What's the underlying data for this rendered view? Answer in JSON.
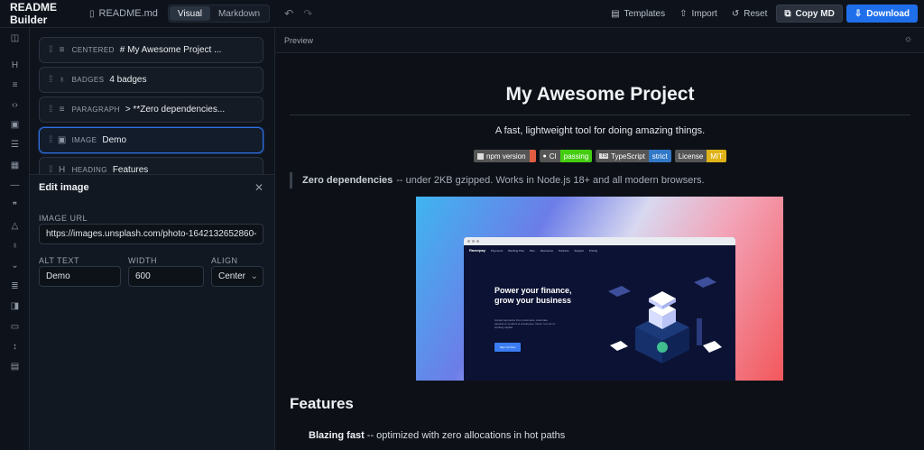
{
  "app": {
    "title": "README Builder",
    "file_name": "README.md"
  },
  "mode_tabs": [
    {
      "label": "Visual",
      "active": true
    },
    {
      "label": "Markdown",
      "active": false
    }
  ],
  "toolbar": {
    "templates": "Templates",
    "import": "Import",
    "reset": "Reset",
    "copy_md": "Copy MD",
    "download": "Download"
  },
  "rail_icons": [
    "sidebar-toggle-icon",
    "heading-icon",
    "paragraph-icon",
    "code-icon",
    "image-icon",
    "list-icon",
    "table-icon",
    "divider-icon",
    "quote-icon",
    "alert-icon",
    "badge-icon",
    "details-icon",
    "align-icon",
    "columns-icon",
    "button-icon",
    "spacer-icon",
    "toc-icon"
  ],
  "blocks": [
    {
      "type": "CENTERED",
      "text": "# My Awesome Project ...",
      "icon": "align-center-icon",
      "selected": false
    },
    {
      "type": "BADGES",
      "text": "4 badges",
      "icon": "badge-icon",
      "selected": false
    },
    {
      "type": "PARAGRAPH",
      "text": "> **Zero dependencies...",
      "icon": "paragraph-icon",
      "selected": false
    },
    {
      "type": "IMAGE",
      "text": "Demo",
      "icon": "image-icon",
      "selected": true
    },
    {
      "type": "HEADING",
      "text": "Features",
      "icon": "heading-icon",
      "selected": false
    }
  ],
  "edit_panel": {
    "title": "Edit image",
    "image_url_label": "IMAGE URL",
    "image_url_value": "https://images.unsplash.com/photo-1642132652860-",
    "alt_label": "ALT TEXT",
    "alt_value": "Demo",
    "width_label": "WIDTH",
    "width_value": "600",
    "align_label": "ALIGN",
    "align_value": "Center"
  },
  "preview": {
    "label": "Preview",
    "h1": "My Awesome Project",
    "tagline": "A fast, lightweight tool for doing amazing things.",
    "badges": [
      {
        "label": "npm version",
        "value": "",
        "color": "#e05d44"
      },
      {
        "label": "CI",
        "value": "passing",
        "color": "#4c1"
      },
      {
        "label": "TypeScript",
        "value": "strict",
        "color": "#3178c6"
      },
      {
        "label": "License",
        "value": "MIT",
        "color": "#dfb317"
      }
    ],
    "quote_bold": "Zero dependencies",
    "quote_rest": "-- under 2KB gzipped. Works in Node.js 18+ and all modern browsers.",
    "demo_image": {
      "alt": "Demo",
      "brand": "Razorpay",
      "headline": "Power your finance, grow your business",
      "sub": "Accept payments from customers. Automate payouts to vendors & employees. Never run out of working capital.",
      "cta": "Sign Up Now",
      "nav": [
        "Payments",
        "Banking Plus",
        "Plus",
        "Resources",
        "Partners",
        "Support",
        "Pricing"
      ]
    },
    "h2": "Features",
    "feature_bold": "Blazing fast",
    "feature_rest": "-- optimized with zero allocations in hot paths"
  }
}
